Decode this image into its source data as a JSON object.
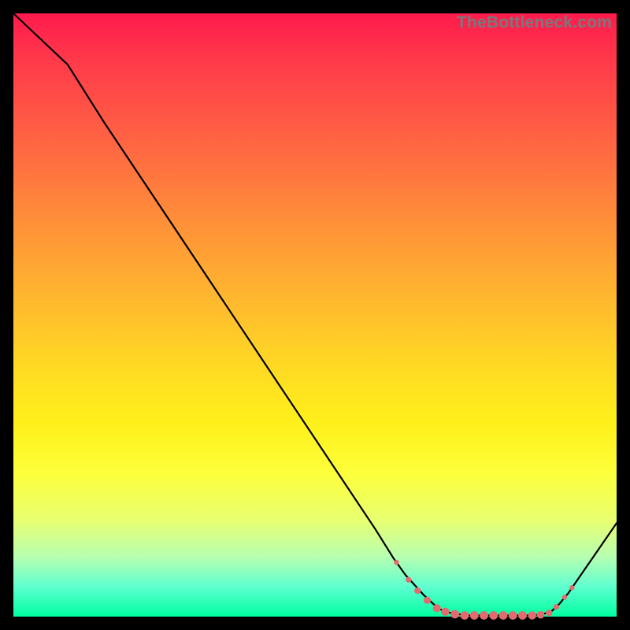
{
  "watermark": "TheBottleneck.com",
  "colors": {
    "background": "#000000",
    "line": "#000000",
    "marker": "#e36b6f",
    "gradient_top": "#ff1a4d",
    "gradient_bottom": "#00ffa0"
  },
  "chart_data": {
    "type": "line",
    "title": "",
    "xlabel": "",
    "ylabel": "",
    "xlim": [
      0,
      100
    ],
    "ylim": [
      0,
      100
    ],
    "grid": false,
    "legend": false,
    "series": [
      {
        "name": "curve",
        "x": [
          0,
          9,
          15,
          20,
          25,
          30,
          35,
          40,
          45,
          50,
          55,
          60,
          63,
          65,
          68,
          70.5,
          72,
          75,
          77,
          79,
          81,
          83,
          85,
          87,
          89,
          90.5,
          92,
          94,
          96,
          98,
          100
        ],
        "y": [
          100,
          91.5,
          82,
          74.5,
          67,
          59.5,
          52,
          44.5,
          37,
          29.5,
          22,
          14.5,
          9.7,
          6.9,
          3.6,
          1.3,
          0.7,
          0.2,
          0.2,
          0.2,
          0.2,
          0.2,
          0.2,
          0.3,
          0.7,
          2.1,
          3.9,
          6.8,
          9.7,
          12.6,
          15.5
        ]
      },
      {
        "name": "markers",
        "type": "scatter",
        "points": [
          {
            "x": 63.5,
            "y": 9.0,
            "r": 3.2
          },
          {
            "x": 65.5,
            "y": 6.1,
            "r": 3.6
          },
          {
            "x": 67.0,
            "y": 4.3,
            "r": 4.2
          },
          {
            "x": 68.6,
            "y": 2.7,
            "r": 4.6
          },
          {
            "x": 70.2,
            "y": 1.4,
            "r": 5.0
          },
          {
            "x": 71.6,
            "y": 0.8,
            "r": 5.2
          },
          {
            "x": 73.2,
            "y": 0.4,
            "r": 5.4
          },
          {
            "x": 74.8,
            "y": 0.2,
            "r": 5.4
          },
          {
            "x": 76.4,
            "y": 0.2,
            "r": 5.4
          },
          {
            "x": 78.0,
            "y": 0.2,
            "r": 5.4
          },
          {
            "x": 79.6,
            "y": 0.2,
            "r": 5.4
          },
          {
            "x": 81.2,
            "y": 0.2,
            "r": 5.4
          },
          {
            "x": 82.8,
            "y": 0.2,
            "r": 5.4
          },
          {
            "x": 84.4,
            "y": 0.2,
            "r": 5.4
          },
          {
            "x": 86.0,
            "y": 0.2,
            "r": 5.2
          },
          {
            "x": 87.4,
            "y": 0.3,
            "r": 4.8
          },
          {
            "x": 88.8,
            "y": 0.6,
            "r": 4.2
          },
          {
            "x": 90.0,
            "y": 1.6,
            "r": 3.6
          },
          {
            "x": 91.4,
            "y": 3.2,
            "r": 3.2
          },
          {
            "x": 92.6,
            "y": 4.8,
            "r": 3.2
          }
        ]
      }
    ]
  }
}
